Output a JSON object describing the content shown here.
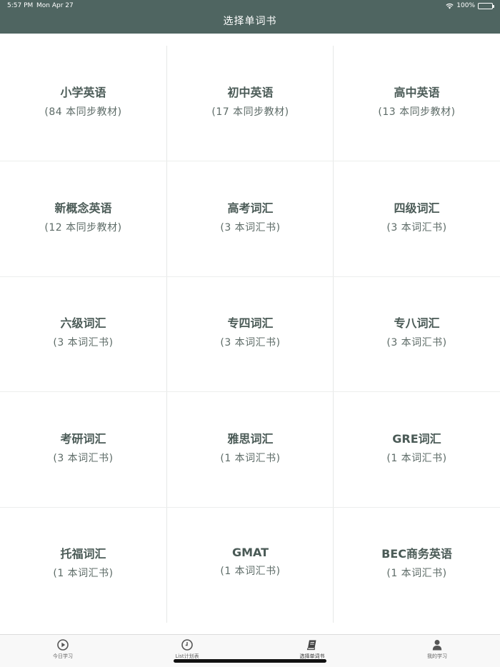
{
  "status_bar": {
    "time": "5:57 PM",
    "date": "Mon Apr 27",
    "battery": "100%"
  },
  "nav": {
    "title": "选择单词书"
  },
  "books": [
    {
      "title": "小学英语",
      "subtitle": "(84 本同步教材)"
    },
    {
      "title": "初中英语",
      "subtitle": "(17 本同步教材)"
    },
    {
      "title": "高中英语",
      "subtitle": "(13 本同步教材)"
    },
    {
      "title": "新概念英语",
      "subtitle": "(12 本同步教材)"
    },
    {
      "title": "高考词汇",
      "subtitle": "(3 本词汇书)"
    },
    {
      "title": "四级词汇",
      "subtitle": "(3 本词汇书)"
    },
    {
      "title": "六级词汇",
      "subtitle": "(3 本词汇书)"
    },
    {
      "title": "专四词汇",
      "subtitle": "(3 本词汇书)"
    },
    {
      "title": "专八词汇",
      "subtitle": "(3 本词汇书)"
    },
    {
      "title": "考研词汇",
      "subtitle": "(3 本词汇书)"
    },
    {
      "title": "雅思词汇",
      "subtitle": "(1 本词汇书)"
    },
    {
      "title": "GRE词汇",
      "subtitle": "(1 本词汇书)"
    },
    {
      "title": "托福词汇",
      "subtitle": "(1 本词汇书)"
    },
    {
      "title": "GMAT",
      "subtitle": "(1 本词汇书)"
    },
    {
      "title": "BEC商务英语",
      "subtitle": "(1 本词汇书)"
    }
  ],
  "tabbar": {
    "items": [
      {
        "label": "今日学习",
        "icon": "play-circle-icon"
      },
      {
        "label": "List计划表",
        "icon": "clock-icon"
      },
      {
        "label": "选择单词书",
        "icon": "book-icon",
        "active": true
      },
      {
        "label": "我的学习",
        "icon": "person-icon"
      }
    ]
  }
}
